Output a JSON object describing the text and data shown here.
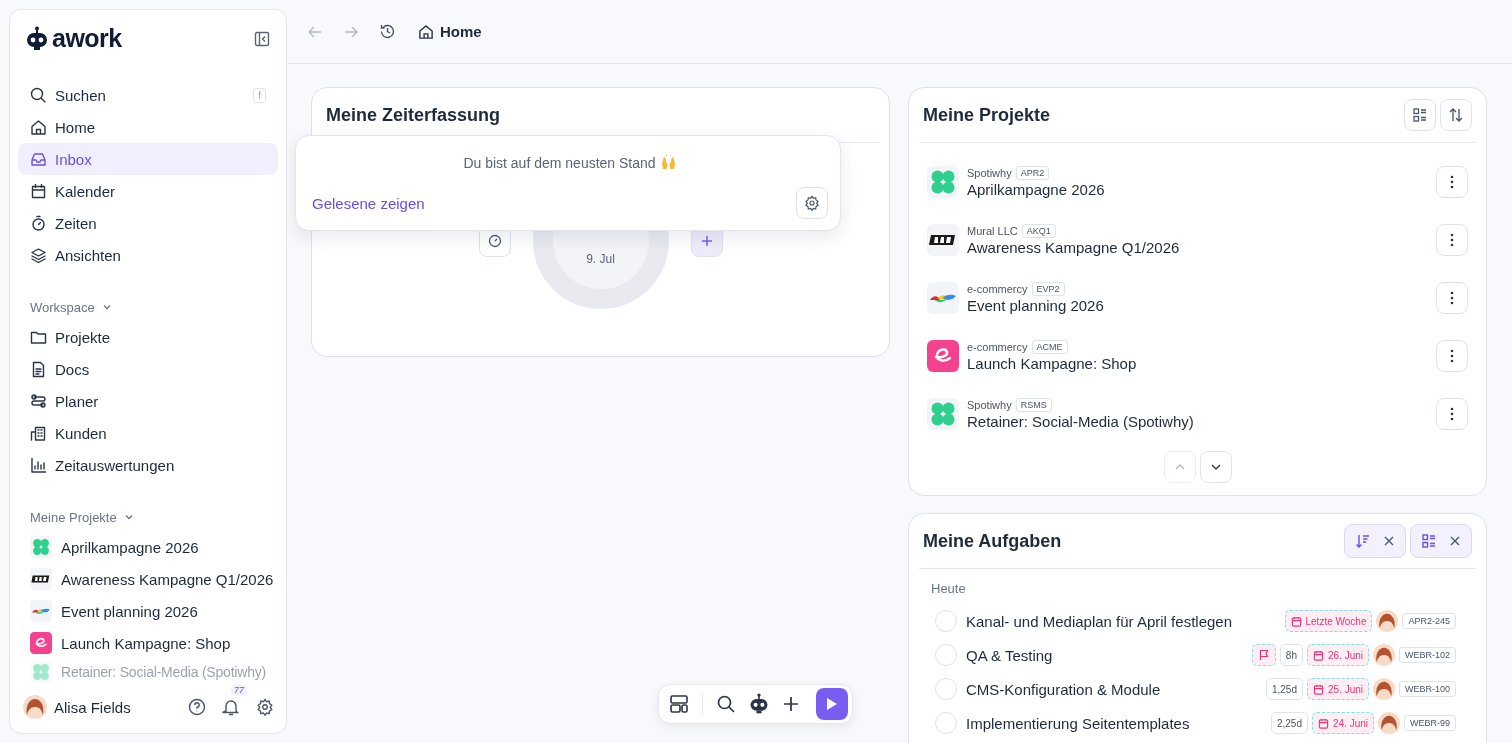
{
  "sidebar": {
    "logo": "awork",
    "nav": [
      {
        "label": "Suchen",
        "shortcut": "f",
        "selected": false
      },
      {
        "label": "Home",
        "selected": false
      },
      {
        "label": "Inbox",
        "selected": true
      },
      {
        "label": "Kalender",
        "selected": false
      },
      {
        "label": "Zeiten",
        "selected": false
      },
      {
        "label": "Ansichten",
        "selected": false
      }
    ],
    "workspace": {
      "title": "Workspace",
      "expanded": true,
      "items": [
        {
          "label": "Projekte"
        },
        {
          "label": "Docs"
        },
        {
          "label": "Planer"
        },
        {
          "label": "Kunden"
        },
        {
          "label": "Zeitauswertungen"
        }
      ]
    },
    "my_projects": {
      "title": "Meine Projekte",
      "expanded": true,
      "items": [
        {
          "label": "Aprilkampagne 2026"
        },
        {
          "label": "Awareness Kampagne Q1/2026"
        },
        {
          "label": "Event planning 2026"
        },
        {
          "label": "Launch Kampagne: Shop"
        },
        {
          "label": "Retainer: Social-Media (Spotiwhy)"
        }
      ]
    },
    "user": {
      "name": "Alisa Fields",
      "notifications": "77"
    }
  },
  "topbar": {
    "breadcrumb": "Home"
  },
  "time_card": {
    "title": "Meine Zeiterfassung",
    "date": "9. Jul"
  },
  "inbox_popover": {
    "message": "Du bist auf dem neusten Stand",
    "link": "Gelesene zeigen"
  },
  "projects_card": {
    "title": "Meine Projekte",
    "projects": [
      {
        "client": "Spotiwhy",
        "code": "APR2",
        "name": "Aprilkampagne 2026"
      },
      {
        "client": "Mural LLC",
        "code": "AKQ1",
        "name": "Awareness Kampagne Q1/2026"
      },
      {
        "client": "e-commercy",
        "code": "EVP2",
        "name": "Event planning 2026"
      },
      {
        "client": "e-commercy",
        "code": "ACME",
        "name": "Launch Kampagne: Shop"
      },
      {
        "client": "Spotiwhy",
        "code": "RSMS",
        "name": "Retainer: Social-Media (Spotiwhy)"
      }
    ]
  },
  "tasks_card": {
    "title": "Meine Aufgaben",
    "group": "Heute",
    "tasks": [
      {
        "title": "Kanal- und Mediaplan für April festlegen",
        "checked": false,
        "flagged": false,
        "due": "Letzte Woche",
        "key": "APR2-245"
      },
      {
        "title": "QA & Testing",
        "checked": false,
        "flagged": true,
        "effort": "8h",
        "due": "26. Juni",
        "key": "WEBR-102"
      },
      {
        "title": "CMS-Konfiguration & Module",
        "checked": false,
        "flagged": false,
        "effort": "1,25d",
        "due": "25. Juni",
        "key": "WEBR-100"
      },
      {
        "title": "Implementierung Seitentemplates",
        "checked": false,
        "flagged": false,
        "effort": "2,25d",
        "due": "24. Juni",
        "key": "WEBR-99"
      }
    ]
  }
}
